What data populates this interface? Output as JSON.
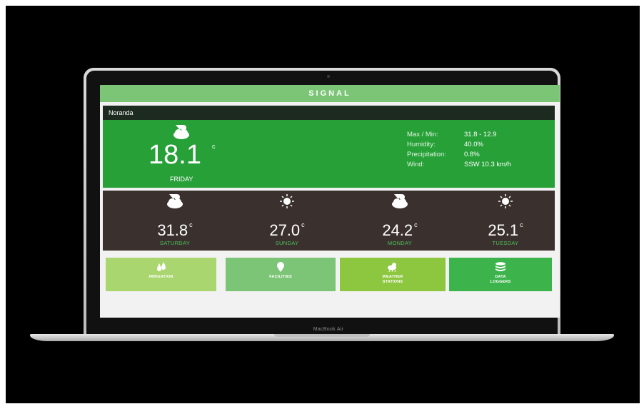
{
  "device": {
    "label": "MacBook Air"
  },
  "app": {
    "title": "SIGNAL"
  },
  "current": {
    "location": "Noranda",
    "temperature": "18.1",
    "unit": "c",
    "day": "FRIDAY",
    "icon": "partly-cloudy-icon",
    "stats": [
      {
        "label": "Max / Min:",
        "value": "31.8 - 12.9"
      },
      {
        "label": "Humidity:",
        "value": "40.0%"
      },
      {
        "label": "Precipitation:",
        "value": "0.8%"
      },
      {
        "label": "Wind:",
        "value": "SSW 10.3 km/h"
      }
    ]
  },
  "forecast": [
    {
      "temp": "31.8",
      "unit": "c",
      "day": "SATURDAY",
      "icon": "partly-cloudy-icon"
    },
    {
      "temp": "27.0",
      "unit": "c",
      "day": "SUNDAY",
      "icon": "sunny-icon"
    },
    {
      "temp": "24.2",
      "unit": "c",
      "day": "MONDAY",
      "icon": "partly-cloudy-icon"
    },
    {
      "temp": "25.1",
      "unit": "c",
      "day": "TUESDAY",
      "icon": "sunny-icon"
    }
  ],
  "tiles": [
    {
      "label": "IRRIGATION",
      "icon": "water-drops-icon",
      "color": "#a9d66f"
    },
    {
      "label": "FACILITIES",
      "icon": "location-pin-icon",
      "color": "#7cc576"
    },
    {
      "label_line1": "WEATHER",
      "label_line2": "STATIONS",
      "icon": "weather-station-icon",
      "color": "#8dc63f"
    },
    {
      "label_line1": "DATA",
      "label_line2": "LOGGERS",
      "icon": "database-icon",
      "color": "#3cb44b"
    }
  ],
  "colors": {
    "topbar": "#7cc576",
    "current_bg": "#27a038",
    "location_bar": "#1d2a1f",
    "forecast_bg": "#3a302d",
    "day_name": "#4ec25c"
  }
}
